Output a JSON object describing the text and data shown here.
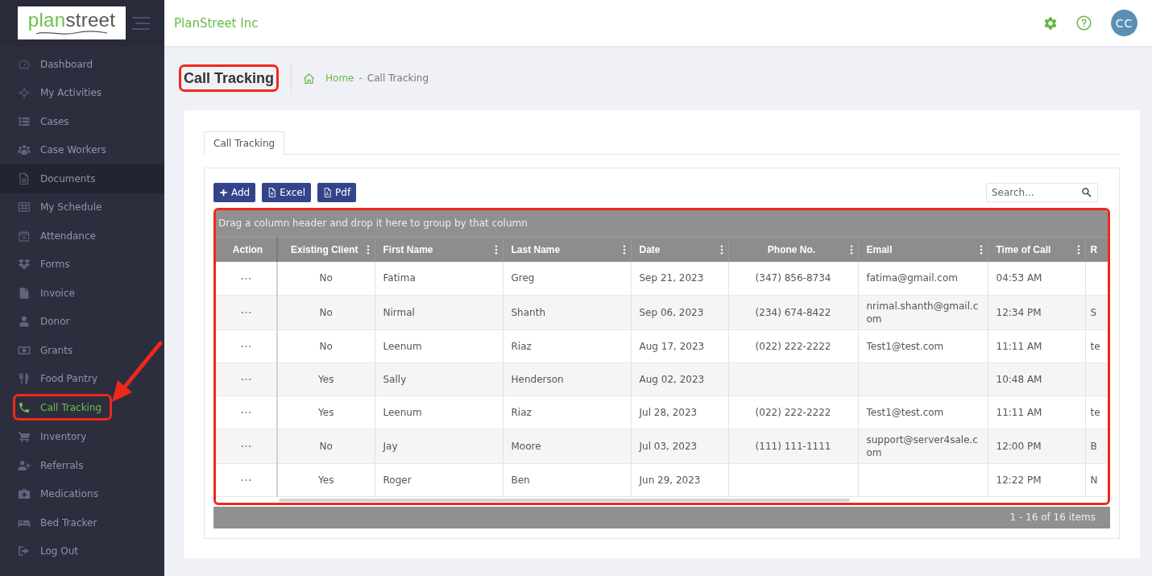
{
  "sidebar": {
    "logo": {
      "parts": [
        "plan",
        "street"
      ]
    },
    "items": [
      {
        "label": "Dashboard",
        "selected": false,
        "hovered": false,
        "highlighted": false
      },
      {
        "label": "My Activities",
        "selected": false,
        "hovered": false,
        "highlighted": false
      },
      {
        "label": "Cases",
        "selected": false,
        "hovered": false,
        "highlighted": false
      },
      {
        "label": "Case Workers",
        "selected": false,
        "hovered": false,
        "highlighted": false
      },
      {
        "label": "Documents",
        "selected": false,
        "hovered": true,
        "highlighted": false
      },
      {
        "label": "My Schedule",
        "selected": false,
        "hovered": false,
        "highlighted": false
      },
      {
        "label": "Attendance",
        "selected": false,
        "hovered": false,
        "highlighted": false
      },
      {
        "label": "Forms",
        "selected": false,
        "hovered": false,
        "highlighted": false
      },
      {
        "label": "Invoice",
        "selected": false,
        "hovered": false,
        "highlighted": false
      },
      {
        "label": "Donor",
        "selected": false,
        "hovered": false,
        "highlighted": false
      },
      {
        "label": "Grants",
        "selected": false,
        "hovered": false,
        "highlighted": false
      },
      {
        "label": "Food Pantry",
        "selected": false,
        "hovered": false,
        "highlighted": false
      },
      {
        "label": "Call Tracking",
        "selected": true,
        "hovered": false,
        "highlighted": true
      },
      {
        "label": "Inventory",
        "selected": false,
        "hovered": false,
        "highlighted": false
      },
      {
        "label": "Referrals",
        "selected": false,
        "hovered": false,
        "highlighted": false
      },
      {
        "label": "Medications",
        "selected": false,
        "hovered": false,
        "highlighted": false
      },
      {
        "label": "Bed Tracker",
        "selected": false,
        "hovered": false,
        "highlighted": false
      },
      {
        "label": "Log Out",
        "selected": false,
        "hovered": false,
        "highlighted": false
      }
    ]
  },
  "top_bar": {
    "company": "PlanStreet Inc",
    "avatar_initials": "CC"
  },
  "page": {
    "title": {
      "text": "Call Tracking",
      "highlighted": true
    },
    "breadcrumb": [
      {
        "label": "Home",
        "kind": "link"
      },
      {
        "label": "Call Tracking",
        "kind": "current"
      }
    ],
    "breadcrumb_separator": "-"
  },
  "tabs": [
    {
      "label": "Call Tracking",
      "selected": true
    }
  ],
  "toolbar": {
    "buttons": [
      {
        "label": "Add",
        "kind": "add"
      },
      {
        "label": "Excel",
        "kind": "excel"
      },
      {
        "label": "Pdf",
        "kind": "pdf"
      }
    ],
    "search": {
      "placeholder": "Search..."
    }
  },
  "grid": {
    "highlighted": true,
    "group_hint": "Drag a column header and drop it here to group by that column",
    "columns": [
      {
        "label": "Action",
        "kind": "action",
        "menu": false
      },
      {
        "label": "Existing Client",
        "kind": "flag",
        "menu": true
      },
      {
        "label": "First Name",
        "kind": "text",
        "menu": true
      },
      {
        "label": "Last Name",
        "kind": "text",
        "menu": true
      },
      {
        "label": "Date",
        "kind": "date",
        "menu": true
      },
      {
        "label": "Phone No.",
        "kind": "phone",
        "menu": true
      },
      {
        "label": "Email",
        "kind": "email",
        "menu": true
      },
      {
        "label": "Time of Call",
        "kind": "time",
        "menu": true
      },
      {
        "label": "R",
        "kind": "text",
        "menu": false
      }
    ],
    "rows": [
      {
        "cells": [
          null,
          "No",
          "Fatima",
          "Greg",
          "Sep 21, 2023",
          "(347) 856-8734",
          "fatima@gmail.com",
          "04:53 AM",
          null
        ]
      },
      {
        "cells": [
          null,
          "No",
          "Nirmal",
          "Shanth",
          "Sep 06, 2023",
          "(234) 674-8422",
          "nrimal.shanth@gmail.com",
          "12:34 PM",
          "S"
        ]
      },
      {
        "cells": [
          null,
          "No",
          "Leenum",
          "Riaz",
          "Aug 17, 2023",
          "(022) 222-2222",
          "Test1@test.com",
          "11:11 AM",
          "te"
        ]
      },
      {
        "cells": [
          null,
          "Yes",
          "Sally",
          "Henderson",
          "Aug 02, 2023",
          null,
          null,
          "10:48 AM",
          null
        ]
      },
      {
        "cells": [
          null,
          "Yes",
          "Leenum",
          "Riaz",
          "Jul 28, 2023",
          "(022) 222-2222",
          "Test1@test.com",
          "11:11 AM",
          "te"
        ]
      },
      {
        "cells": [
          null,
          "No",
          "Jay",
          "Moore",
          "Jul 03, 2023",
          "(111) 111-1111",
          "support@server4sale.com",
          "12:00 PM",
          "B"
        ]
      },
      {
        "cells": [
          null,
          "Yes",
          "Roger",
          "Ben",
          "Jun 29, 2023",
          null,
          null,
          "12:22 PM",
          "N"
        ]
      }
    ],
    "pager": "1 - 16 of 16 items"
  }
}
